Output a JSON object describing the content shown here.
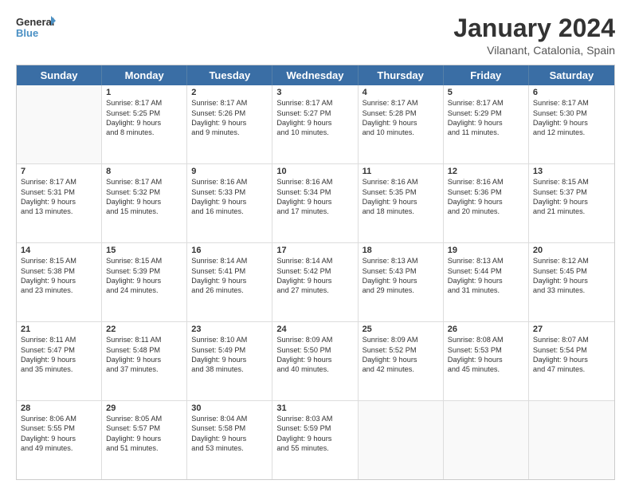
{
  "logo": {
    "line1": "General",
    "line2": "Blue"
  },
  "title": "January 2024",
  "subtitle": "Vilanant, Catalonia, Spain",
  "dayHeaders": [
    "Sunday",
    "Monday",
    "Tuesday",
    "Wednesday",
    "Thursday",
    "Friday",
    "Saturday"
  ],
  "weeks": [
    [
      {
        "num": "",
        "info": ""
      },
      {
        "num": "1",
        "info": "Sunrise: 8:17 AM\nSunset: 5:25 PM\nDaylight: 9 hours\nand 8 minutes."
      },
      {
        "num": "2",
        "info": "Sunrise: 8:17 AM\nSunset: 5:26 PM\nDaylight: 9 hours\nand 9 minutes."
      },
      {
        "num": "3",
        "info": "Sunrise: 8:17 AM\nSunset: 5:27 PM\nDaylight: 9 hours\nand 10 minutes."
      },
      {
        "num": "4",
        "info": "Sunrise: 8:17 AM\nSunset: 5:28 PM\nDaylight: 9 hours\nand 10 minutes."
      },
      {
        "num": "5",
        "info": "Sunrise: 8:17 AM\nSunset: 5:29 PM\nDaylight: 9 hours\nand 11 minutes."
      },
      {
        "num": "6",
        "info": "Sunrise: 8:17 AM\nSunset: 5:30 PM\nDaylight: 9 hours\nand 12 minutes."
      }
    ],
    [
      {
        "num": "7",
        "info": "Sunrise: 8:17 AM\nSunset: 5:31 PM\nDaylight: 9 hours\nand 13 minutes."
      },
      {
        "num": "8",
        "info": "Sunrise: 8:17 AM\nSunset: 5:32 PM\nDaylight: 9 hours\nand 15 minutes."
      },
      {
        "num": "9",
        "info": "Sunrise: 8:16 AM\nSunset: 5:33 PM\nDaylight: 9 hours\nand 16 minutes."
      },
      {
        "num": "10",
        "info": "Sunrise: 8:16 AM\nSunset: 5:34 PM\nDaylight: 9 hours\nand 17 minutes."
      },
      {
        "num": "11",
        "info": "Sunrise: 8:16 AM\nSunset: 5:35 PM\nDaylight: 9 hours\nand 18 minutes."
      },
      {
        "num": "12",
        "info": "Sunrise: 8:16 AM\nSunset: 5:36 PM\nDaylight: 9 hours\nand 20 minutes."
      },
      {
        "num": "13",
        "info": "Sunrise: 8:15 AM\nSunset: 5:37 PM\nDaylight: 9 hours\nand 21 minutes."
      }
    ],
    [
      {
        "num": "14",
        "info": "Sunrise: 8:15 AM\nSunset: 5:38 PM\nDaylight: 9 hours\nand 23 minutes."
      },
      {
        "num": "15",
        "info": "Sunrise: 8:15 AM\nSunset: 5:39 PM\nDaylight: 9 hours\nand 24 minutes."
      },
      {
        "num": "16",
        "info": "Sunrise: 8:14 AM\nSunset: 5:41 PM\nDaylight: 9 hours\nand 26 minutes."
      },
      {
        "num": "17",
        "info": "Sunrise: 8:14 AM\nSunset: 5:42 PM\nDaylight: 9 hours\nand 27 minutes."
      },
      {
        "num": "18",
        "info": "Sunrise: 8:13 AM\nSunset: 5:43 PM\nDaylight: 9 hours\nand 29 minutes."
      },
      {
        "num": "19",
        "info": "Sunrise: 8:13 AM\nSunset: 5:44 PM\nDaylight: 9 hours\nand 31 minutes."
      },
      {
        "num": "20",
        "info": "Sunrise: 8:12 AM\nSunset: 5:45 PM\nDaylight: 9 hours\nand 33 minutes."
      }
    ],
    [
      {
        "num": "21",
        "info": "Sunrise: 8:11 AM\nSunset: 5:47 PM\nDaylight: 9 hours\nand 35 minutes."
      },
      {
        "num": "22",
        "info": "Sunrise: 8:11 AM\nSunset: 5:48 PM\nDaylight: 9 hours\nand 37 minutes."
      },
      {
        "num": "23",
        "info": "Sunrise: 8:10 AM\nSunset: 5:49 PM\nDaylight: 9 hours\nand 38 minutes."
      },
      {
        "num": "24",
        "info": "Sunrise: 8:09 AM\nSunset: 5:50 PM\nDaylight: 9 hours\nand 40 minutes."
      },
      {
        "num": "25",
        "info": "Sunrise: 8:09 AM\nSunset: 5:52 PM\nDaylight: 9 hours\nand 42 minutes."
      },
      {
        "num": "26",
        "info": "Sunrise: 8:08 AM\nSunset: 5:53 PM\nDaylight: 9 hours\nand 45 minutes."
      },
      {
        "num": "27",
        "info": "Sunrise: 8:07 AM\nSunset: 5:54 PM\nDaylight: 9 hours\nand 47 minutes."
      }
    ],
    [
      {
        "num": "28",
        "info": "Sunrise: 8:06 AM\nSunset: 5:55 PM\nDaylight: 9 hours\nand 49 minutes."
      },
      {
        "num": "29",
        "info": "Sunrise: 8:05 AM\nSunset: 5:57 PM\nDaylight: 9 hours\nand 51 minutes."
      },
      {
        "num": "30",
        "info": "Sunrise: 8:04 AM\nSunset: 5:58 PM\nDaylight: 9 hours\nand 53 minutes."
      },
      {
        "num": "31",
        "info": "Sunrise: 8:03 AM\nSunset: 5:59 PM\nDaylight: 9 hours\nand 55 minutes."
      },
      {
        "num": "",
        "info": ""
      },
      {
        "num": "",
        "info": ""
      },
      {
        "num": "",
        "info": ""
      }
    ]
  ]
}
